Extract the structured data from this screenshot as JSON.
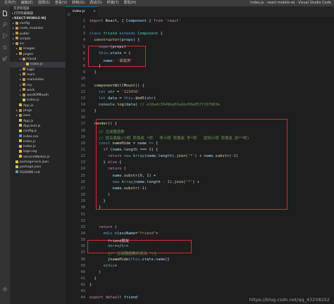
{
  "window": {
    "title": "index.js - react-mobile-wj - Visual Studio Code",
    "menus": [
      "文件(F)",
      "编辑(E)",
      "选择(S)",
      "查看(V)",
      "转到(G)",
      "调试(D)",
      "终端(T)",
      "帮助(H)"
    ]
  },
  "sidebar": {
    "header": "资源管理器",
    "open_editors": "打开的编辑器",
    "project": "REACT-MOBILE-WJ",
    "items": [
      {
        "label": "config",
        "depth": 0,
        "kind": "folder",
        "arrow": "▸"
      },
      {
        "label": "node_modules",
        "depth": 0,
        "kind": "folder",
        "arrow": "▸"
      },
      {
        "label": "public",
        "depth": 0,
        "kind": "folder",
        "arrow": "▸"
      },
      {
        "label": "scripts",
        "depth": 0,
        "kind": "folder",
        "arrow": "▸"
      },
      {
        "label": "src",
        "depth": 0,
        "kind": "folder",
        "arrow": "▾"
      },
      {
        "label": "images",
        "depth": 1,
        "kind": "folder",
        "arrow": "▸"
      },
      {
        "label": "pages",
        "depth": 1,
        "kind": "folder",
        "arrow": "▾"
      },
      {
        "label": "friend",
        "depth": 2,
        "kind": "folder",
        "arrow": "▾"
      },
      {
        "label": "index.js",
        "depth": 3,
        "kind": "js",
        "arrow": "",
        "selected": true
      },
      {
        "label": "login",
        "depth": 2,
        "kind": "folder",
        "arrow": "▸"
      },
      {
        "label": "main",
        "depth": 2,
        "kind": "folder",
        "arrow": "▸"
      },
      {
        "label": "mainindex",
        "depth": 2,
        "kind": "folder",
        "arrow": "▸"
      },
      {
        "label": "my",
        "depth": 2,
        "kind": "folder",
        "arrow": "▸"
      },
      {
        "label": "work",
        "depth": 2,
        "kind": "folder",
        "arrow": "▸"
      },
      {
        "label": "wordOfMouth",
        "depth": 2,
        "kind": "folder",
        "arrow": "▸"
      },
      {
        "label": "index.js",
        "depth": 2,
        "kind": "js",
        "arrow": ""
      },
      {
        "label": "App.js",
        "depth": 1,
        "kind": "js",
        "arrow": ""
      },
      {
        "label": "plugs",
        "depth": 1,
        "kind": "folder",
        "arrow": "▸"
      },
      {
        "label": "sass",
        "depth": 1,
        "kind": "folder",
        "arrow": "▸"
      },
      {
        "label": "App.js",
        "depth": 1,
        "kind": "js",
        "arrow": ""
      },
      {
        "label": "App.test.js",
        "depth": 1,
        "kind": "js",
        "arrow": ""
      },
      {
        "label": "config.js",
        "depth": 1,
        "kind": "js",
        "arrow": ""
      },
      {
        "label": "index.css",
        "depth": 1,
        "kind": "css",
        "arrow": ""
      },
      {
        "label": "index.js",
        "depth": 1,
        "kind": "js",
        "arrow": ""
      },
      {
        "label": "index.js",
        "depth": 1,
        "kind": "js",
        "arrow": ""
      },
      {
        "label": "logo.svg",
        "depth": 1,
        "kind": "svg",
        "arrow": ""
      },
      {
        "label": "serviceWorker.js",
        "depth": 1,
        "kind": "js",
        "arrow": ""
      },
      {
        "label": "package-lock.json",
        "depth": 0,
        "kind": "json",
        "arrow": ""
      },
      {
        "label": "package.json",
        "depth": 0,
        "kind": "json",
        "arrow": ""
      },
      {
        "label": "README.md",
        "depth": 0,
        "kind": "md",
        "arrow": ""
      }
    ]
  },
  "tab": {
    "label": "index.js",
    "close": "×"
  },
  "editor": {
    "lines": [
      {
        "n": "1",
        "html": "<span class='kw'>import</span> React, { <span class='v'>Component</span> } <span class='kw'>from</span> <span class='s'>'react'</span>"
      },
      {
        "n": "2",
        "html": ""
      },
      {
        "n": "3",
        "html": "<span class='k'>class</span> <span class='t'>friend</span> <span class='k'>extends</span> <span class='t'>Component</span> {"
      },
      {
        "n": "4",
        "html": "  <span class='f'>constructor</span>(<span class='v'>props</span>) {"
      },
      {
        "n": "5",
        "html": "    <span class='k'>super</span>(<span class='v'>props</span>)"
      },
      {
        "n": "6",
        "html": "    <span class='k'>this</span>.<span class='v'>state</span> = {"
      },
      {
        "n": "7",
        "html": "      <span class='v'>name</span>: <span class='s'>'谁最美'</span>"
      },
      {
        "n": "8",
        "html": "    }"
      },
      {
        "n": "9",
        "html": "  }"
      },
      {
        "n": "10",
        "html": ""
      },
      {
        "n": "11",
        "html": "  <span class='f'>componentWillMount</span>() {"
      },
      {
        "n": "12",
        "html": "    <span class='k'>let</span> <span class='v'>str</span> = <span class='s'>'123456'</span>"
      },
      {
        "n": "13",
        "html": "    <span class='k'>let</span> <span class='v'>data</span> = <span class='k'>this</span>.<span class='f'>$md5</span>(<span class='v'>str</span>)"
      },
      {
        "n": "14",
        "html": "    <span class='v'>console</span>.<span class='f'>log</span>(<span class='v'>data</span>) <span class='c'>// e10adc3949ba59abbe56e057f20f883e</span>"
      },
      {
        "n": "15",
        "html": "  }"
      },
      {
        "n": "16",
        "html": ""
      },
      {
        "n": "17",
        "html": "  <span class='f'>render</span>() {"
      },
      {
        "n": "18",
        "html": "    <span class='c'>// 过滤器函数</span>"
      },
      {
        "n": "19",
        "html": "    <span class='c'>// 姓名脱敏(小明 转换成 *明   李小明 转换成 李*明   欧阳小明 转换成 欧**明)</span>"
      },
      {
        "n": "20",
        "html": "    <span class='k'>const</span> <span class='f'>nameHide</span> = <span class='v'>name</span> <span class='k'>=&gt;</span> {"
      },
      {
        "n": "21",
        "html": "      <span class='kw'>if</span> (<span class='v'>name</span>.<span class='v'>length</span> === <span class='n'>2</span>) {"
      },
      {
        "n": "22",
        "html": "        <span class='kw'>return</span> <span class='k'>new</span> <span class='t'>Array</span>(<span class='v'>name</span>.<span class='v'>length</span>).<span class='f'>join</span>(<span class='s'>'*'</span>) + <span class='v'>name</span>.<span class='f'>substr</span>(<span class='n'>-1</span>)"
      },
      {
        "n": "23",
        "html": "      } <span class='kw'>else</span> {"
      },
      {
        "n": "24",
        "html": "        <span class='kw'>return</span> ("
      },
      {
        "n": "25",
        "html": "          <span class='v'>name</span>.<span class='f'>substr</span>(<span class='n'>0</span>, <span class='n'>1</span>) +"
      },
      {
        "n": "26",
        "html": "          <span class='k'>new</span> <span class='t'>Array</span>(<span class='v'>name</span>.<span class='v'>length</span> - <span class='n'>1</span>).<span class='f'>join</span>(<span class='s'>'*'</span>) +"
      },
      {
        "n": "27",
        "html": "          <span class='v'>name</span>.<span class='f'>substr</span>(<span class='n'>-1</span>)"
      },
      {
        "n": "28",
        "html": "        )"
      },
      {
        "n": "29",
        "html": "      }"
      },
      {
        "n": "30",
        "html": "    }"
      },
      {
        "n": "31",
        "html": ""
      },
      {
        "n": "32",
        "html": ""
      },
      {
        "n": "33",
        "html": "    <span class='kw'>return</span> ("
      },
      {
        "n": "34",
        "html": "      &lt;<span class='k'>div</span> <span class='v'>className</span>=<span class='s'>\"friend\"</span>&gt;"
      },
      {
        "n": "35",
        "html": "        friend朋友"
      },
      {
        "n": "36",
        "html": "        &lt;<span class='k'>br</span>&gt;&lt;/<span class='k'>br</span>&gt;"
      },
      {
        "n": "37",
        "html": "        <span class='c'>{/* 过滤器函数的用法 */}</span>"
      },
      {
        "n": "38",
        "html": "        {<span class='f'>nameHide</span>(<span class='k'>this</span>.<span class='v'>state</span>.<span class='v'>name</span>)}"
      },
      {
        "n": "39",
        "html": "      &lt;/<span class='k'>div</span>&gt;"
      },
      {
        "n": "40",
        "html": "    )"
      },
      {
        "n": "41",
        "html": "  }"
      },
      {
        "n": "42",
        "html": "}"
      },
      {
        "n": "43",
        "html": ""
      },
      {
        "n": "44",
        "html": "<span class='kw'>export</span> <span class='kw'>default</span> <span class='v'>friend</span>"
      }
    ]
  },
  "watermark": "https://blog.csdn.net/qq_43258252"
}
